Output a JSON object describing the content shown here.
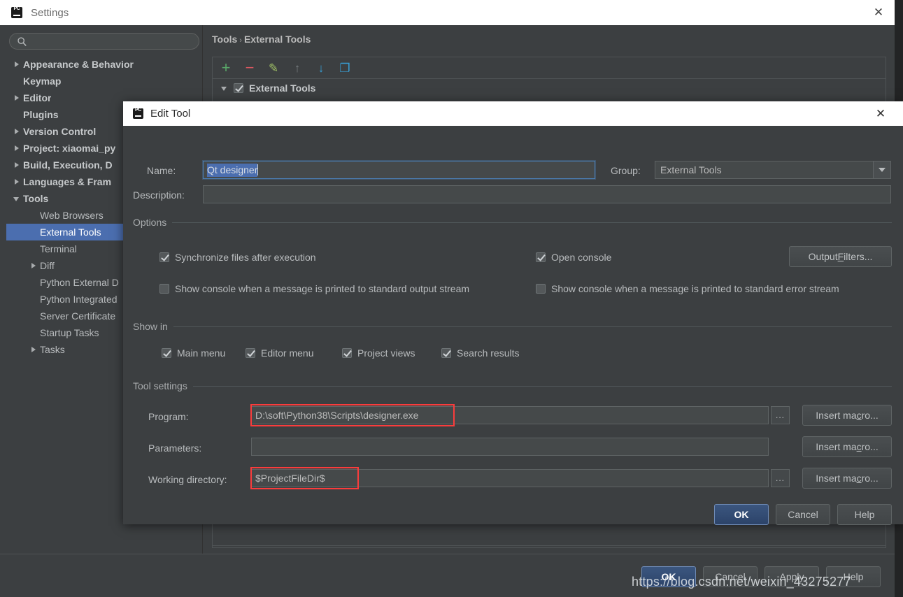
{
  "window": {
    "title": "Settings",
    "app_icon": "pycharm-icon",
    "close_icon": "close-icon"
  },
  "sidebar": {
    "search": {
      "value": "",
      "placeholder": "",
      "icon": "search-icon"
    },
    "items": [
      {
        "label": "Appearance & Behavior",
        "arrow": "collapsed",
        "indent": 0,
        "bold": true,
        "selected": false
      },
      {
        "label": "Keymap",
        "arrow": "none",
        "indent": 0,
        "bold": true,
        "selected": false
      },
      {
        "label": "Editor",
        "arrow": "collapsed",
        "indent": 0,
        "bold": true,
        "selected": false
      },
      {
        "label": "Plugins",
        "arrow": "none",
        "indent": 0,
        "bold": true,
        "selected": false
      },
      {
        "label": "Version Control",
        "arrow": "collapsed",
        "indent": 0,
        "bold": true,
        "selected": false
      },
      {
        "label": "Project: xiaomai_py",
        "arrow": "collapsed",
        "indent": 0,
        "bold": true,
        "selected": false
      },
      {
        "label": "Build, Execution, D",
        "arrow": "collapsed",
        "indent": 0,
        "bold": true,
        "selected": false
      },
      {
        "label": "Languages & Fram",
        "arrow": "collapsed",
        "indent": 0,
        "bold": true,
        "selected": false
      },
      {
        "label": "Tools",
        "arrow": "expanded",
        "indent": 0,
        "bold": true,
        "selected": false
      },
      {
        "label": "Web Browsers",
        "arrow": "none",
        "indent": 1,
        "bold": false,
        "selected": false
      },
      {
        "label": "External Tools",
        "arrow": "none",
        "indent": 1,
        "bold": false,
        "selected": true
      },
      {
        "label": "Terminal",
        "arrow": "none",
        "indent": 1,
        "bold": false,
        "selected": false
      },
      {
        "label": "Diff",
        "arrow": "collapsed",
        "indent": 1,
        "bold": false,
        "selected": false
      },
      {
        "label": "Python External D",
        "arrow": "none",
        "indent": 1,
        "bold": false,
        "selected": false
      },
      {
        "label": "Python Integrated",
        "arrow": "none",
        "indent": 1,
        "bold": false,
        "selected": false
      },
      {
        "label": "Server Certificate",
        "arrow": "none",
        "indent": 1,
        "bold": false,
        "selected": false
      },
      {
        "label": "Startup Tasks",
        "arrow": "none",
        "indent": 1,
        "bold": false,
        "selected": false
      },
      {
        "label": "Tasks",
        "arrow": "collapsed",
        "indent": 1,
        "bold": false,
        "selected": false
      }
    ]
  },
  "detail": {
    "breadcrumb_root": "Tools",
    "breadcrumb_sep": "›",
    "breadcrumb_leaf": "External Tools",
    "toolbar": [
      {
        "name": "add-icon",
        "glyph": "+",
        "color": "#59a869"
      },
      {
        "name": "remove-icon",
        "glyph": "−",
        "color": "#db5860"
      },
      {
        "name": "edit-icon",
        "glyph": "✎",
        "color": "#a0c066"
      },
      {
        "name": "move-up-icon",
        "glyph": "↑",
        "color": "#787d80"
      },
      {
        "name": "move-down-icon",
        "glyph": "↓",
        "color": "#389fd6"
      },
      {
        "name": "copy-icon",
        "glyph": "❐",
        "color": "#389fd6"
      }
    ],
    "group_row_label": "External Tools"
  },
  "footer": {
    "buttons": [
      {
        "label": "OK",
        "default": true
      },
      {
        "label": "Cancel",
        "default": false
      },
      {
        "label": "Apply",
        "default": false
      },
      {
        "label": "Help",
        "default": false
      }
    ]
  },
  "dialog": {
    "title": "Edit Tool",
    "close_icon": "close-icon",
    "name_label": "Name:",
    "name_value": "Qt designer",
    "group_label": "Group:",
    "group_value": "External Tools",
    "description_label": "Description:",
    "description_value": "",
    "options_section": "Options",
    "options": [
      {
        "label": "Synchronize files after execution",
        "checked": true
      },
      {
        "label": "Open console",
        "checked": true
      },
      {
        "label": "Show console when a message is printed to standard output stream",
        "checked": false
      },
      {
        "label": "Show console when a message is printed to standard error stream",
        "checked": false
      }
    ],
    "output_filters_button": {
      "pre": "Output ",
      "mnemonic": "F",
      "post": "ilters..."
    },
    "show_in_section": "Show in",
    "show_in": [
      {
        "label": "Main menu",
        "checked": true
      },
      {
        "label": "Editor menu",
        "checked": true
      },
      {
        "label": "Project views",
        "checked": true
      },
      {
        "label": "Search results",
        "checked": true
      }
    ],
    "tool_settings_section": "Tool settings",
    "program_label": "Program:",
    "program_value": "D:\\soft\\Python38\\Scripts\\designer.exe",
    "parameters_label": "Parameters:",
    "parameters_value": "",
    "working_dir_label": "Working directory:",
    "working_dir_value": "$ProjectFileDir$",
    "browse_glyph": "...",
    "insert_macro_button": {
      "pre": "Insert ma",
      "mnemonic": "c",
      "post": "ro..."
    },
    "buttons": [
      {
        "label": "OK",
        "default": true
      },
      {
        "label": "Cancel",
        "default": false
      },
      {
        "label": "Help",
        "default": false
      }
    ]
  },
  "watermark": "https://blog.csdn.net/weixin_43275277",
  "colors": {
    "accent_selection": "#4b6eaf",
    "annotation_red": "#fa3c3c",
    "panel_bg": "#3c3f41",
    "field_bg": "#45494a"
  }
}
